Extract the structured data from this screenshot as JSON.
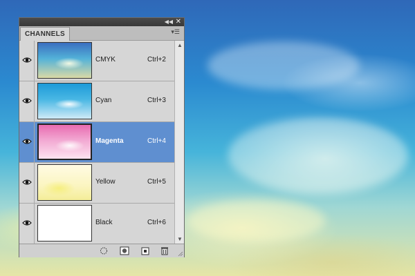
{
  "panel": {
    "tab_label": "CHANNELS",
    "controls": {
      "collapse_icon": "double-chevron-icon",
      "close_icon": "close-icon",
      "menu_icon": "panel-menu-icon"
    }
  },
  "channels": [
    {
      "name": "CMYK",
      "shortcut": "Ctrl+2",
      "visible": true,
      "selected": false,
      "thumb": "cmyk"
    },
    {
      "name": "Cyan",
      "shortcut": "Ctrl+3",
      "visible": true,
      "selected": false,
      "thumb": "cyan"
    },
    {
      "name": "Magenta",
      "shortcut": "Ctrl+4",
      "visible": true,
      "selected": true,
      "thumb": "magenta"
    },
    {
      "name": "Yellow",
      "shortcut": "Ctrl+5",
      "visible": true,
      "selected": false,
      "thumb": "yellow"
    },
    {
      "name": "Black",
      "shortcut": "Ctrl+6",
      "visible": true,
      "selected": false,
      "thumb": "black"
    }
  ],
  "footer_buttons": [
    {
      "icon": "load-channel-as-selection-icon"
    },
    {
      "icon": "save-selection-as-channel-icon"
    },
    {
      "icon": "new-channel-icon"
    },
    {
      "icon": "trash-icon"
    }
  ],
  "colors": {
    "selected_row": "#5f8fd0",
    "panel_bg": "#d6d6d6",
    "titlebar": "#3f3f3f"
  }
}
